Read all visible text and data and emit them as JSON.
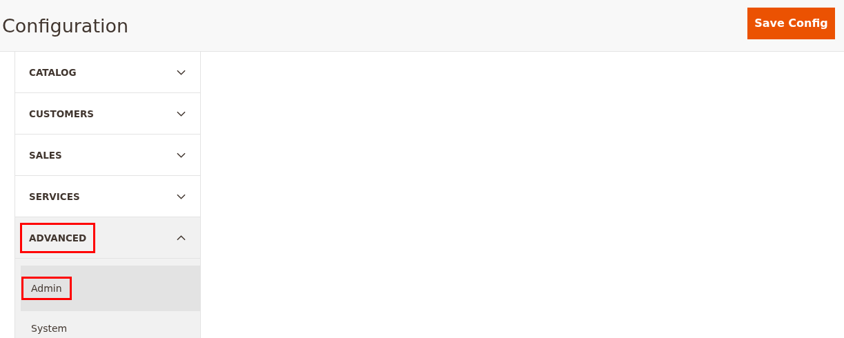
{
  "page_title": "Configuration",
  "save_button": {
    "label": "Save Config"
  },
  "sidebar": {
    "sections": [
      {
        "label": "CATALOG",
        "expanded": false,
        "highlighted": false
      },
      {
        "label": "CUSTOMERS",
        "expanded": false,
        "highlighted": false
      },
      {
        "label": "SALES",
        "expanded": false,
        "highlighted": false
      },
      {
        "label": "SERVICES",
        "expanded": false,
        "highlighted": false
      },
      {
        "label": "ADVANCED",
        "expanded": true,
        "highlighted": true,
        "children": [
          {
            "label": "Admin",
            "selected": true,
            "highlighted": true
          },
          {
            "label": "System",
            "selected": false,
            "highlighted": false
          }
        ]
      }
    ]
  }
}
